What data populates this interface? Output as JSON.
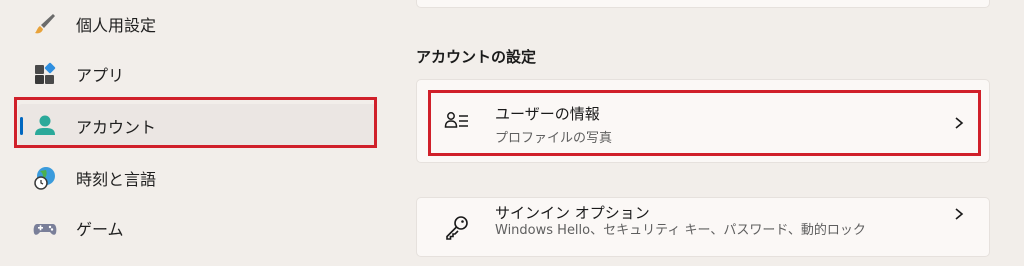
{
  "sidebar": {
    "items": [
      {
        "label": "個人用設定",
        "icon": "paintbrush-icon"
      },
      {
        "label": "アプリ",
        "icon": "apps-icon"
      },
      {
        "label": "アカウント",
        "icon": "account-person-icon"
      },
      {
        "label": "時刻と言語",
        "icon": "globe-clock-icon"
      },
      {
        "label": "ゲーム",
        "icon": "gamepad-icon"
      }
    ],
    "selected_index": 2
  },
  "main": {
    "section_title": "アカウントの設定",
    "cards": [
      {
        "title": "ユーザーの情報",
        "subtitle": "プロファイルの写真",
        "icon": "user-info-icon"
      },
      {
        "title": "サインイン オプション",
        "subtitle": "Windows Hello、セキュリティ キー、パスワード、動的ロック",
        "icon": "key-icon"
      }
    ]
  },
  "colors": {
    "accent": "#0067c0",
    "highlight_box": "#d0202a",
    "background": "#f2eeea",
    "card": "#fbf8f6"
  }
}
